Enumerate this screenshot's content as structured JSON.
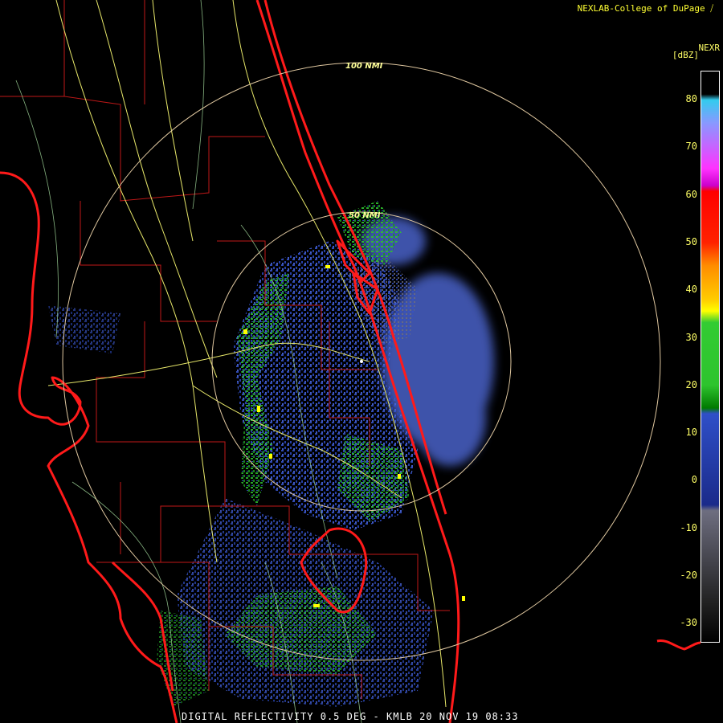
{
  "header": {
    "credit": "NEXLAB-College of DuPage",
    "credit_icon": "cod-logo-icon"
  },
  "legend": {
    "product": "NEXR",
    "unit": "[dBZ]",
    "ticks": [
      "80",
      "70",
      "60",
      "50",
      "40",
      "30",
      "20",
      "10",
      "0",
      "-10",
      "-20",
      "-30"
    ],
    "colors": {
      "gray": "#6e6e80",
      "blue": "#2f4fc8",
      "green": "#2ec42e",
      "yellow": "#ffff00",
      "orange": "#ff8c00",
      "red": "#ff0000",
      "magenta": "#ff33ff",
      "cyan": "#33ccee"
    }
  },
  "range_rings": {
    "labels": [
      "100 NMI",
      "50 NMI"
    ]
  },
  "map_colors": {
    "coast": "#ff1a1a",
    "county": "#c01818",
    "highway": "#e8e86a",
    "road": "#a8e0a0",
    "ring": "#e0c8a0"
  },
  "footer": {
    "caption": "DIGITAL REFLECTIVITY 0.5 DEG - KMLB 20 NOV 19 08:33"
  }
}
